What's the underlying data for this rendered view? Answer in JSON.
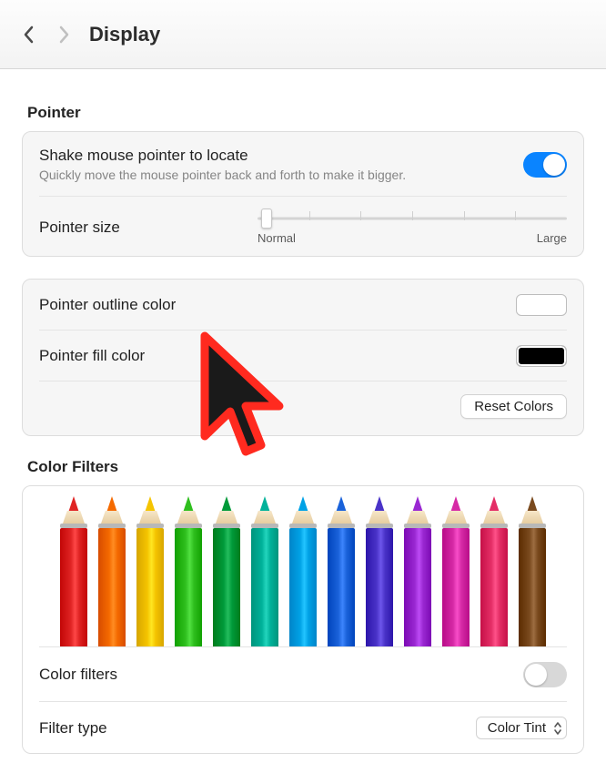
{
  "header": {
    "title": "Display"
  },
  "pointer": {
    "section_title": "Pointer",
    "shake": {
      "label": "Shake mouse pointer to locate",
      "sub": "Quickly move the mouse pointer back and forth to make it bigger.",
      "enabled": true
    },
    "size": {
      "label": "Pointer size",
      "min_label": "Normal",
      "max_label": "Large",
      "value_pct": 3
    },
    "outline": {
      "label": "Pointer outline color",
      "color": "#ffffff"
    },
    "fill": {
      "label": "Pointer fill color",
      "color": "#000000"
    },
    "reset_label": "Reset Colors"
  },
  "color_filters": {
    "section_title": "Color Filters",
    "pencil_colors": [
      "#e02424",
      "#f56a00",
      "#f5c400",
      "#2fbf1e",
      "#009a3a",
      "#00b29a",
      "#00a2e6",
      "#1a62da",
      "#4a33c8",
      "#9a28d2",
      "#d62aa6",
      "#e42e66",
      "#7a4a1e"
    ],
    "toggle": {
      "label": "Color filters",
      "enabled": false
    },
    "filter_type": {
      "label": "Filter type",
      "value": "Color Tint"
    }
  }
}
